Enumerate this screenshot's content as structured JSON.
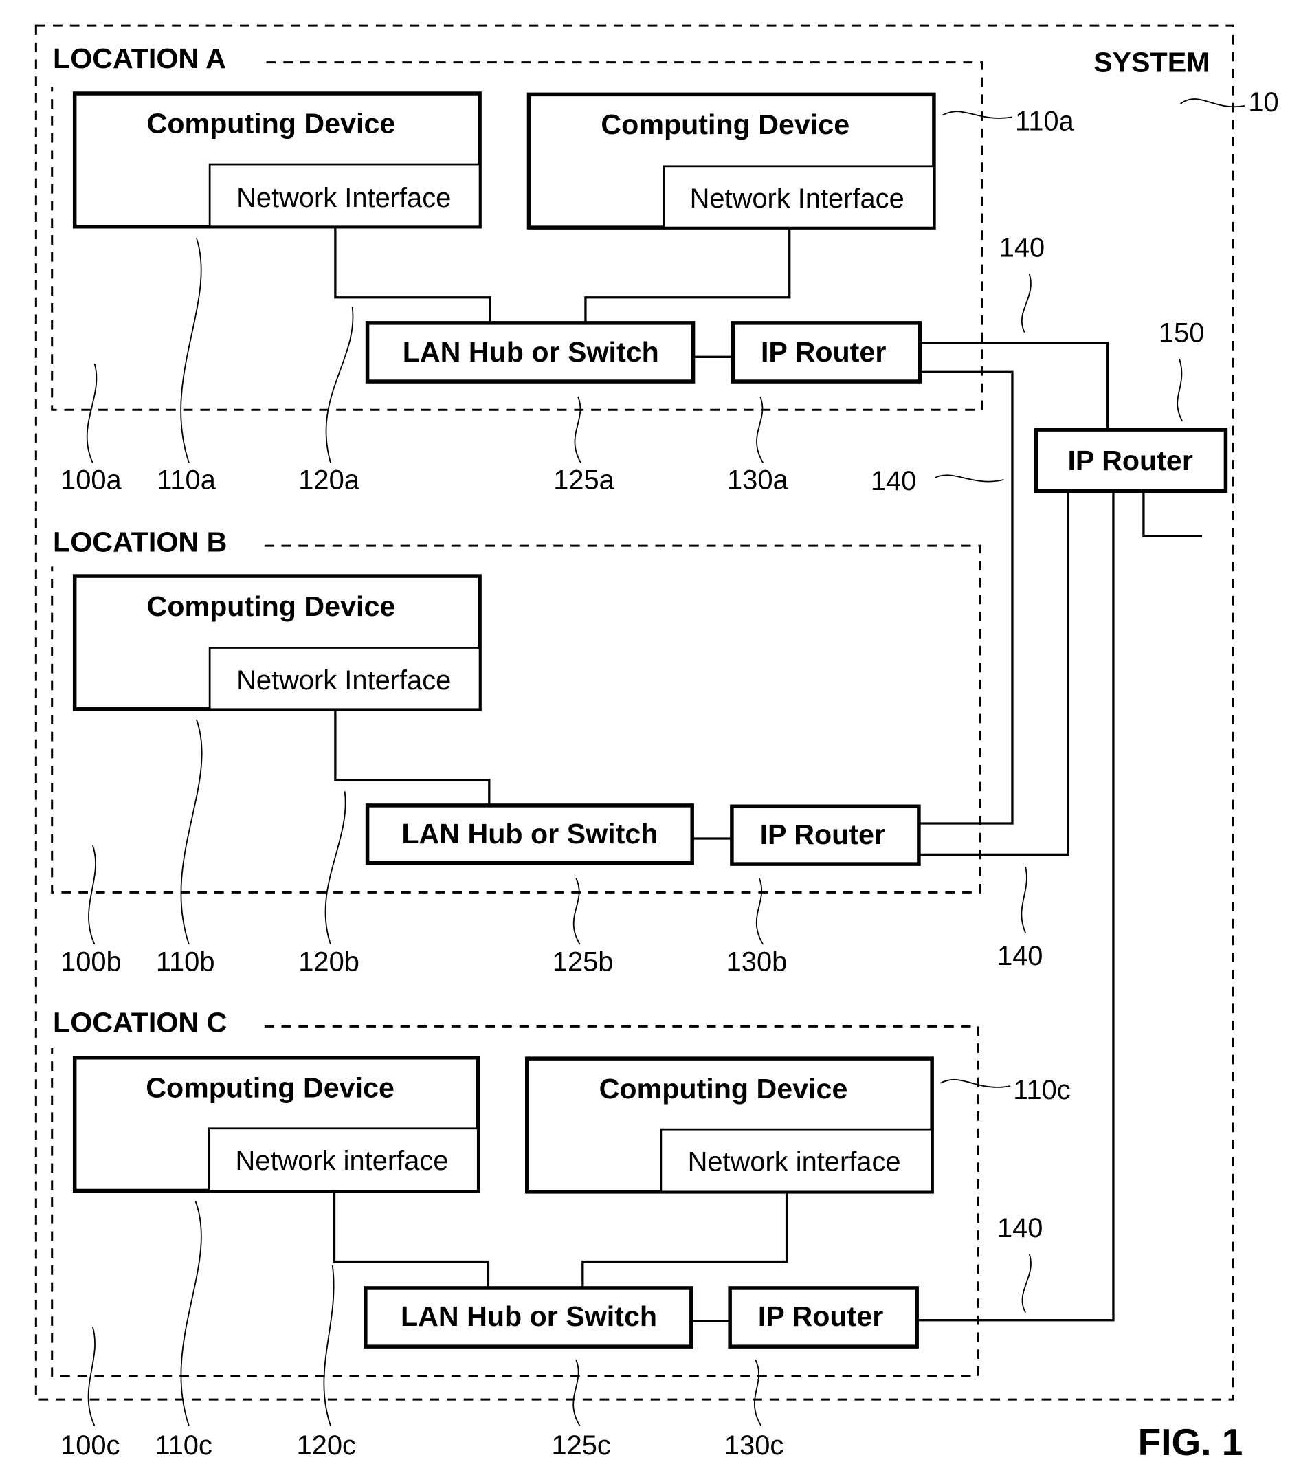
{
  "figure": {
    "system_label": "SYSTEM",
    "system_ref": "10",
    "fig_label": "FIG. 1"
  },
  "locations": [
    {
      "title": "LOCATION A",
      "devices": [
        {
          "label": "Computing Device",
          "interface": "Network Interface"
        },
        {
          "label": "Computing Device",
          "interface": "Network Interface"
        }
      ],
      "hub": "LAN Hub or Switch",
      "router": "IP Router",
      "refs": {
        "location": "100a",
        "device": "110a",
        "device_right": "110a",
        "interface": "120a",
        "hub": "125a",
        "router": "130a"
      }
    },
    {
      "title": "LOCATION B",
      "devices": [
        {
          "label": "Computing Device",
          "interface": "Network Interface"
        }
      ],
      "hub": "LAN Hub or Switch",
      "router": "IP Router",
      "refs": {
        "location": "100b",
        "device": "110b",
        "interface": "120b",
        "hub": "125b",
        "router": "130b"
      }
    },
    {
      "title": "LOCATION C",
      "devices": [
        {
          "label": "Computing Device",
          "interface": "Network interface"
        },
        {
          "label": "Computing Device",
          "interface": "Network interface"
        }
      ],
      "hub": "LAN Hub or Switch",
      "router": "IP Router",
      "refs": {
        "location": "100c",
        "device": "110c",
        "device_right": "110c",
        "interface": "120c",
        "hub": "125c",
        "router": "130c"
      }
    }
  ],
  "central_router": {
    "label": "IP Router",
    "ref": "150"
  },
  "links": {
    "ref_a_top": "140",
    "ref_a_mid": "140",
    "ref_b": "140",
    "ref_c": "140"
  }
}
